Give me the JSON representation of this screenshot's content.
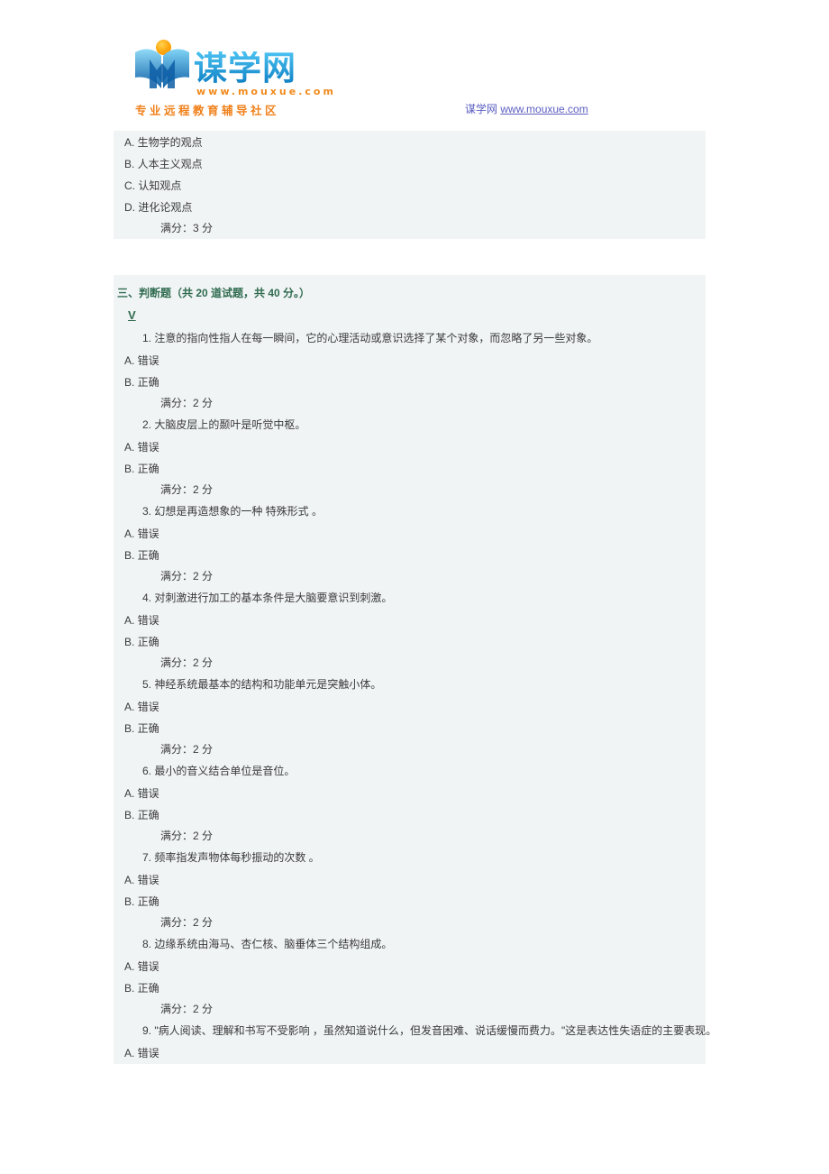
{
  "header": {
    "logo": {
      "word": "谋学网",
      "url": "www.mouxue.com",
      "tagline": "专业远程教育辅导社区"
    },
    "site_ref_name": "谋学网",
    "site_ref_url": "www.mouxue.com"
  },
  "top_question": {
    "options": [
      {
        "label": "A. 生物学的观点"
      },
      {
        "label": "B. 人本主义观点"
      },
      {
        "label": "C. 认知观点"
      },
      {
        "label": "D. 进化论观点"
      }
    ],
    "score": "满分：3 分"
  },
  "section": {
    "title": "三、判断题（共 20 道试题，共 40 分。）",
    "anchor": "V"
  },
  "tf_options": {
    "a": "A. 错误",
    "b": "B. 正确"
  },
  "score_2": "满分：2 分",
  "questions": [
    {
      "text": "1. 注意的指向性指人在每一瞬间，它的心理活动或意识选择了某个对象，而忽略了另一些对象。"
    },
    {
      "text": "2. 大脑皮层上的颞叶是听觉中枢。"
    },
    {
      "text": "3. 幻想是再造想象的一种 特殊形式 。"
    },
    {
      "text": "4. 对刺激进行加工的基本条件是大脑要意识到刺激。"
    },
    {
      "text": "5. 神经系统最基本的结构和功能单元是突触小体。"
    },
    {
      "text": "6. 最小的音义结合单位是音位。"
    },
    {
      "text": "7. 频率指发声物体每秒振动的次数 。"
    },
    {
      "text": "8. 边缘系统由海马、杏仁核、脑垂体三个结构组成。"
    },
    {
      "text": "9. \"病人阅读、理解和书写不受影响 ，虽然知道说什么，但发音困难、说话缓慢而费力。\"这是表达性失语症的主要表现。"
    }
  ],
  "colors": {
    "panel_bg": "#f1f4f5",
    "section_green": "#2f6b4f",
    "link_purple": "#5b5fc0",
    "logo_blue": "#1a9de0",
    "logo_orange": "#f0801a"
  }
}
